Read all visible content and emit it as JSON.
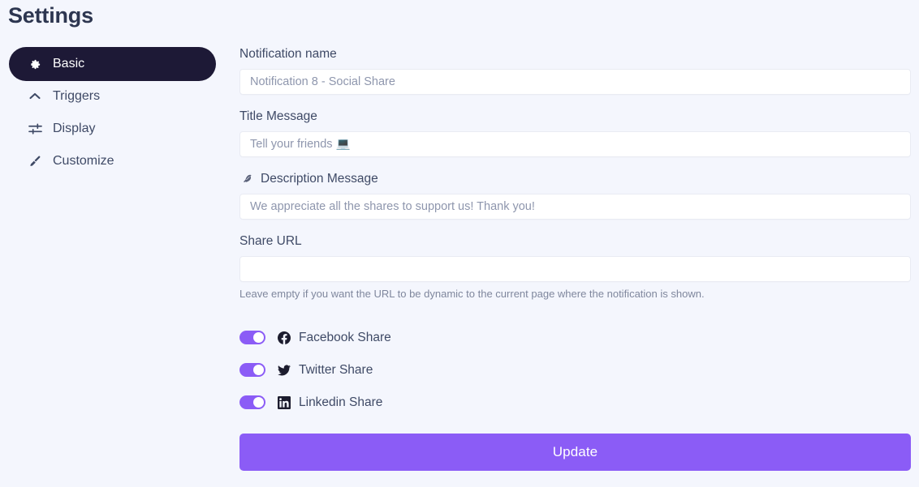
{
  "page": {
    "title": "Settings",
    "background_color": "#f4f6fd"
  },
  "sidebar": {
    "items": [
      {
        "label": "Basic",
        "icon": "gear-icon",
        "active": true
      },
      {
        "label": "Triggers",
        "icon": "chevron-up-icon",
        "active": false
      },
      {
        "label": "Display",
        "icon": "sliders-icon",
        "active": false
      },
      {
        "label": "Customize",
        "icon": "paintbrush-icon",
        "active": false
      }
    ],
    "active_background_color": "#1d1936",
    "active_text_color": "#ffffff"
  },
  "form": {
    "notification_name": {
      "label": "Notification name",
      "value": "",
      "placeholder": "Notification 8 - Social Share"
    },
    "title_message": {
      "label": "Title Message",
      "value": "",
      "placeholder": "Tell your friends 💻"
    },
    "description_message": {
      "label": "Description Message",
      "icon": "feather-icon",
      "value": "",
      "placeholder": "We appreciate all the shares to support us! Thank you!"
    },
    "share_url": {
      "label": "Share URL",
      "value": "",
      "placeholder": "",
      "help_text": "Leave empty if you want the URL to be dynamic to the current page where the notification is shown."
    },
    "toggles": [
      {
        "label": "Facebook Share",
        "icon": "facebook-icon",
        "enabled": true
      },
      {
        "label": "Twitter Share",
        "icon": "twitter-icon",
        "enabled": true
      },
      {
        "label": "Linkedin Share",
        "icon": "linkedin-icon",
        "enabled": true
      }
    ],
    "submit": {
      "label": "Update",
      "color": "#8b5cf6"
    }
  },
  "colors": {
    "accent": "#8b5cf6",
    "dark": "#1d1936",
    "text": "#3f4a66",
    "muted": "#7f879d",
    "background": "#f4f6fd"
  }
}
